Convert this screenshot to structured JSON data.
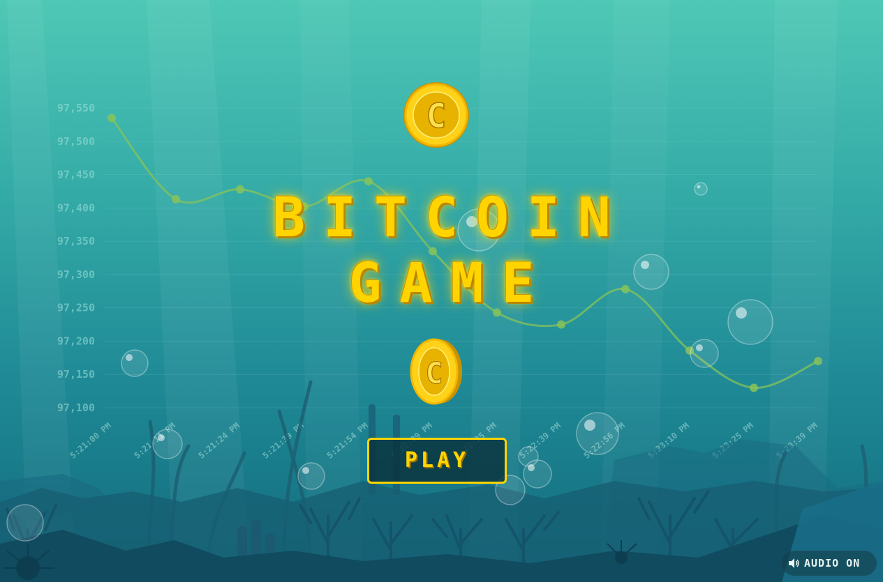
{
  "game": {
    "title_line1": "BITCOIN",
    "title_line2": "GAME",
    "play_label": "PLAY",
    "audio_label": "AUDIO ON",
    "coin_letter": "C"
  },
  "colors": {
    "accent": "#ffd400",
    "line": "#86c35a",
    "water_top": "#4fc8b6",
    "water_bottom": "#126a7c"
  },
  "chart_data": {
    "type": "line",
    "y_ticks": [
      "97,550",
      "97,500",
      "97,450",
      "97,400",
      "97,350",
      "97,300",
      "97,250",
      "97,200",
      "97,150",
      "97,100"
    ],
    "x": [
      "5:21:00 PM",
      "5:21:11 PM",
      "5:21:24 PM",
      "5:21:39 PM",
      "5:21:54 PM",
      "5:22:09 PM",
      "5:22:25 PM",
      "5:22:39 PM",
      "5:22:56 PM",
      "5:23:10 PM",
      "5:23:25 PM",
      "5:23:39 PM"
    ],
    "values": [
      97535,
      97413,
      97428,
      97402,
      97440,
      97335,
      97243,
      97225,
      97278,
      97186,
      97130,
      97170
    ],
    "ylim": [
      97100,
      97550
    ],
    "grid": true
  }
}
